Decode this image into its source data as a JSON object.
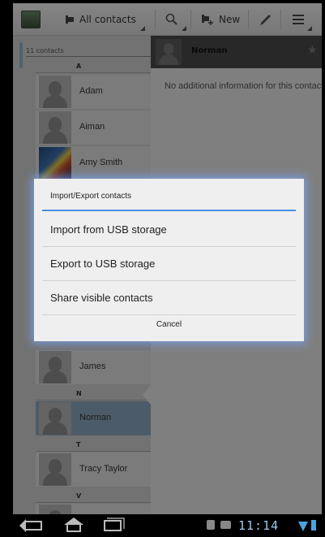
{
  "actionbar": {
    "contacts_filter": "All contacts",
    "new_label": "New",
    "icons": [
      "app-icon",
      "contacts-icon",
      "search-icon",
      "new-contact-icon",
      "edit-icon",
      "menu-icon"
    ]
  },
  "list": {
    "count": "11 contacts",
    "items": [
      {
        "type": "section",
        "label": "A"
      },
      {
        "type": "contact",
        "name": "Adam"
      },
      {
        "type": "contact",
        "name": "Aiman"
      },
      {
        "type": "contact",
        "name": "Amy Smith"
      },
      {
        "type": "contact",
        "name": "James"
      },
      {
        "type": "section",
        "label": "N"
      },
      {
        "type": "contact",
        "name": "Norman",
        "selected": true
      },
      {
        "type": "section",
        "label": "T"
      },
      {
        "type": "contact",
        "name": "Tracy Taylor"
      },
      {
        "type": "section",
        "label": "V"
      }
    ]
  },
  "detail": {
    "name": "Norman",
    "info": "No additional information for this contact"
  },
  "dialog": {
    "title": "Import/Export contacts",
    "options": [
      "Import from USB storage",
      "Export to USB storage",
      "Share visible contacts"
    ],
    "cancel": "Cancel"
  },
  "statusbar": {
    "time": "11:14"
  },
  "colors": {
    "accent": "#4a90e2",
    "selected_row": "#8aa6bf",
    "clock": "#9cc9ee"
  }
}
